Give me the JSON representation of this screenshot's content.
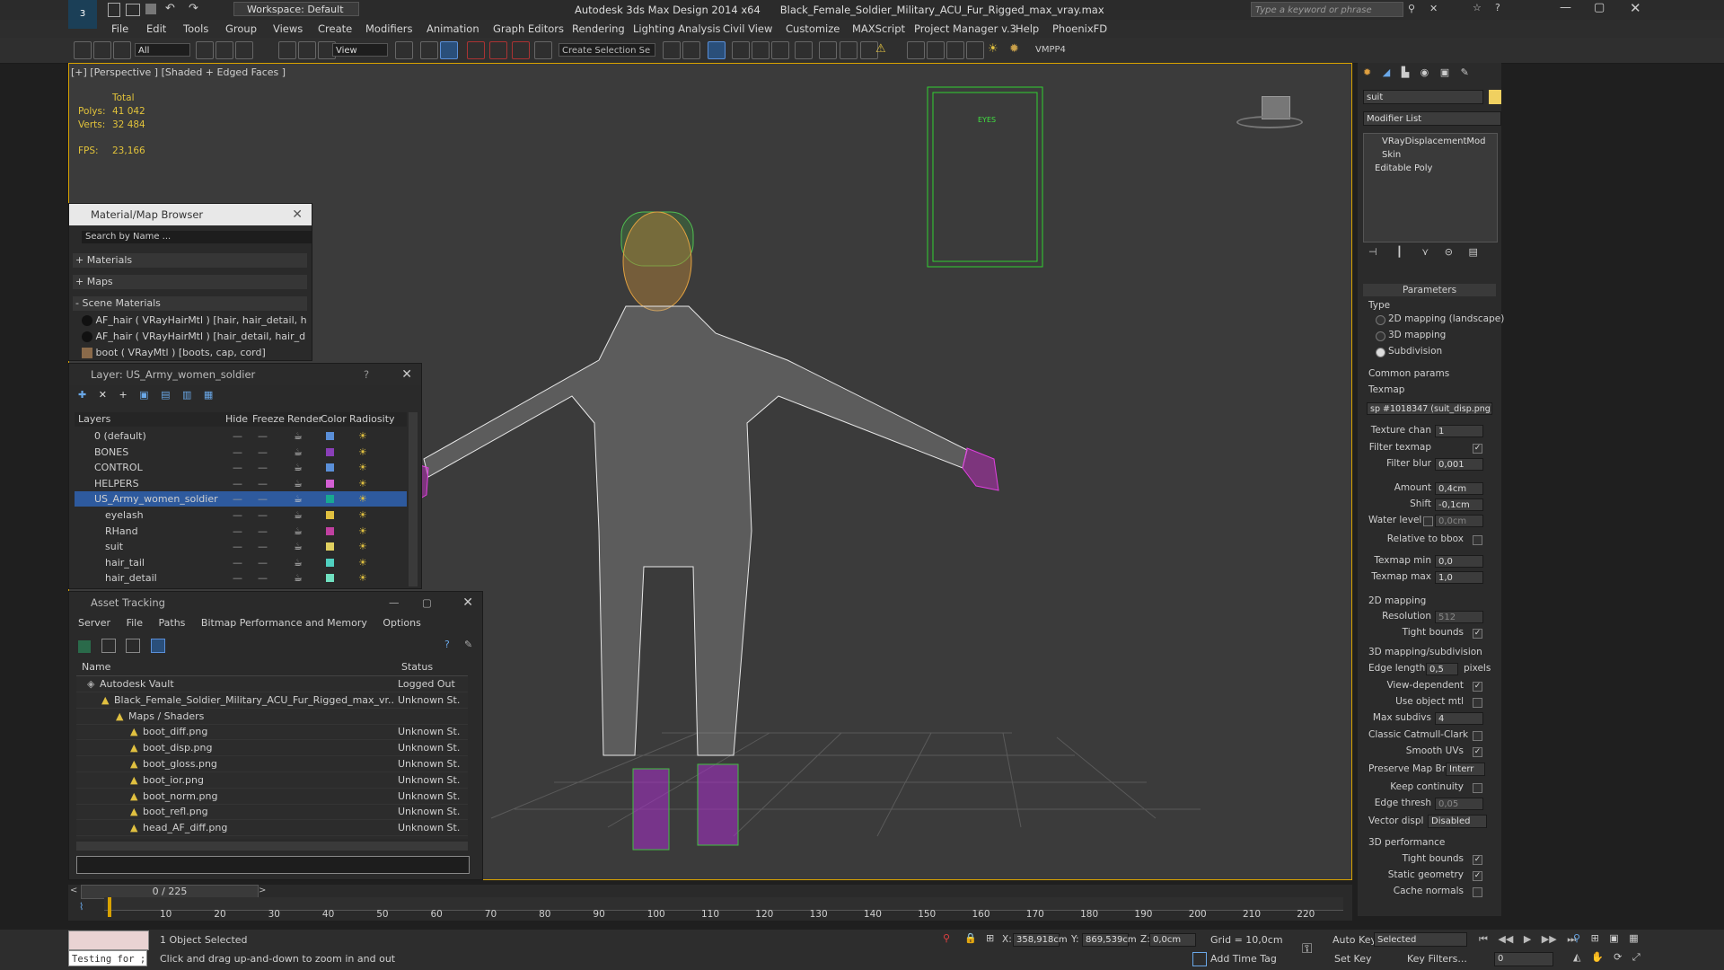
{
  "app": {
    "workspace": "Workspace: Default",
    "title": "Autodesk 3ds Max Design 2014 x64      Black_Female_Soldier_Military_ACU_Fur_Rigged_max_vray.max",
    "search_placeholder": "Type a keyword or phrase"
  },
  "menu": [
    "File",
    "Edit",
    "Tools",
    "Group",
    "Views",
    "Create",
    "Modifiers",
    "Animation",
    "Graph Editors",
    "Rendering",
    "Lighting Analysis",
    "Civil View",
    "Customize",
    "MAXScript",
    "Project Manager v.3",
    "Help",
    "PhoenixFD"
  ],
  "toolbar": {
    "filter": "All",
    "view": "View",
    "selection_set": "Create Selection Se",
    "vmpp": "VMPP4"
  },
  "viewport": {
    "label": "[+] [Perspective ] [Shaded + Edged Faces ]",
    "stats_header": "Total",
    "polys_label": "Polys:",
    "polys": "41 042",
    "verts_label": "Verts:",
    "verts": "32 484",
    "fps_label": "FPS:",
    "fps": "23,166",
    "eyes_label": "EYES"
  },
  "material_browser": {
    "title": "Material/Map Browser",
    "search": "Search by Name ...",
    "groups": [
      "+ Materials",
      "+ Maps",
      "- Scene Materials"
    ],
    "items": [
      "AF_hair  ( VRayHairMtl ) [hair, hair_detail, h...",
      "AF_hair  ( VRayHairMtl ) [hair_detail, hair_d...",
      "boot  ( VRayMtl ) [boots, cap, cord]"
    ]
  },
  "layer_manager": {
    "title": "Layer: US_Army_women_soldier",
    "help": "?",
    "columns": [
      "Layers",
      "Hide",
      "Freeze",
      "Render",
      "Color",
      "Radiosity"
    ],
    "rows": [
      {
        "name": "0 (default)",
        "color": "#5a8fd8"
      },
      {
        "name": "BONES",
        "color": "#8a3fb8"
      },
      {
        "name": "CONTROL",
        "color": "#5a8fd8"
      },
      {
        "name": "HELPERS",
        "color": "#d35fd3"
      },
      {
        "name": "US_Army_women_soldier",
        "color": "#18a890"
      },
      {
        "name": "eyelash",
        "color": "#e0c040"
      },
      {
        "name": "RHand",
        "color": "#c040a0"
      },
      {
        "name": "suit",
        "color": "#e0d060"
      },
      {
        "name": "hair_tail",
        "color": "#50d0c0"
      },
      {
        "name": "hair_detail",
        "color": "#70e0c0"
      }
    ]
  },
  "asset_tracking": {
    "title": "Asset Tracking",
    "menu": [
      "Server",
      "File",
      "Paths",
      "Bitmap Performance and Memory",
      "Options"
    ],
    "columns": [
      "Name",
      "Status"
    ],
    "rows": [
      {
        "name": "Autodesk Vault",
        "status": "Logged Out",
        "indent": 0
      },
      {
        "name": "Black_Female_Soldier_Military_ACU_Fur_Rigged_max_vr...",
        "status": "Unknown St...",
        "indent": 1
      },
      {
        "name": "Maps / Shaders",
        "status": "",
        "indent": 2
      },
      {
        "name": "boot_diff.png",
        "status": "Unknown St...",
        "indent": 3
      },
      {
        "name": "boot_disp.png",
        "status": "Unknown St...",
        "indent": 3
      },
      {
        "name": "boot_gloss.png",
        "status": "Unknown St...",
        "indent": 3
      },
      {
        "name": "boot_ior.png",
        "status": "Unknown St...",
        "indent": 3
      },
      {
        "name": "boot_norm.png",
        "status": "Unknown St...",
        "indent": 3
      },
      {
        "name": "boot_refl.png",
        "status": "Unknown St...",
        "indent": 3
      },
      {
        "name": "head_AF_diff.png",
        "status": "Unknown St...",
        "indent": 3
      }
    ]
  },
  "command_panel": {
    "object_name": "suit",
    "modifier_list": "Modifier List",
    "stack": [
      "VRayDisplacementMod",
      "Skin",
      "Editable Poly"
    ],
    "parameters": "Parameters",
    "type_label": "Type",
    "type_options": [
      "2D mapping (landscape)",
      "3D mapping",
      "Subdivision"
    ],
    "common_params": "Common params",
    "texmap_label": "Texmap",
    "texmap_value": "sp #1018347 (suit_disp.png)",
    "texture_chan_label": "Texture chan",
    "texture_chan": "1",
    "filter_texmap": "Filter texmap",
    "filter_blur_label": "Filter blur",
    "filter_blur": "0,001",
    "amount_label": "Amount",
    "amount": "0,4cm",
    "shift_label": "Shift",
    "shift": "-0,1cm",
    "water_level_label": "Water level",
    "water_level": "0,0cm",
    "relative_bbox": "Relative to bbox",
    "texmap_min_label": "Texmap min",
    "texmap_min": "0,0",
    "texmap_max_label": "Texmap max",
    "texmap_max": "1,0",
    "mapping2d": "2D mapping",
    "resolution_label": "Resolution",
    "resolution": "512",
    "tight_bounds": "Tight bounds",
    "mapping3d": "3D mapping/subdivision",
    "edge_length_label": "Edge length",
    "edge_length": "0,5",
    "pixels": "pixels",
    "view_dependent": "View-dependent",
    "use_object_mtl": "Use object mtl",
    "max_subdivs_label": "Max subdivs",
    "max_subdivs": "4",
    "classic_catmull": "Classic Catmull-Clark",
    "smooth_uvs": "Smooth UVs",
    "preserve_map_label": "Preserve Map Bnd",
    "preserve_map": "Interr",
    "keep_continuity": "Keep continuity",
    "edge_thresh_label": "Edge thresh",
    "edge_thresh": "0,05",
    "vector_displ_label": "Vector displ",
    "vector_displ": "Disabled",
    "perf3d": "3D performance",
    "tight_bounds2": "Tight bounds",
    "static_geometry": "Static geometry",
    "cache_normals": "Cache normals"
  },
  "timeline": {
    "frame": "0 / 225",
    "ticks": [
      "10",
      "20",
      "30",
      "40",
      "50",
      "60",
      "70",
      "80",
      "90",
      "100",
      "110",
      "120",
      "130",
      "140",
      "150",
      "160",
      "170",
      "180",
      "190",
      "200",
      "210",
      "220"
    ]
  },
  "status": {
    "script_label": "Testing for ;",
    "selected": "1 Object Selected",
    "hint": "Click and drag up-and-down to zoom in and out",
    "x_label": "X:",
    "x": "358,918cm",
    "y_label": "Y:",
    "y": "869,539cm",
    "z_label": "Z:",
    "z": "0,0cm",
    "grid": "Grid = 10,0cm",
    "auto_key": "Auto Key",
    "selected_mode": "Selected",
    "set_key": "Set Key",
    "key_filters": "Key Filters...",
    "add_time_tag": "Add Time Tag",
    "frame_field": "0"
  }
}
